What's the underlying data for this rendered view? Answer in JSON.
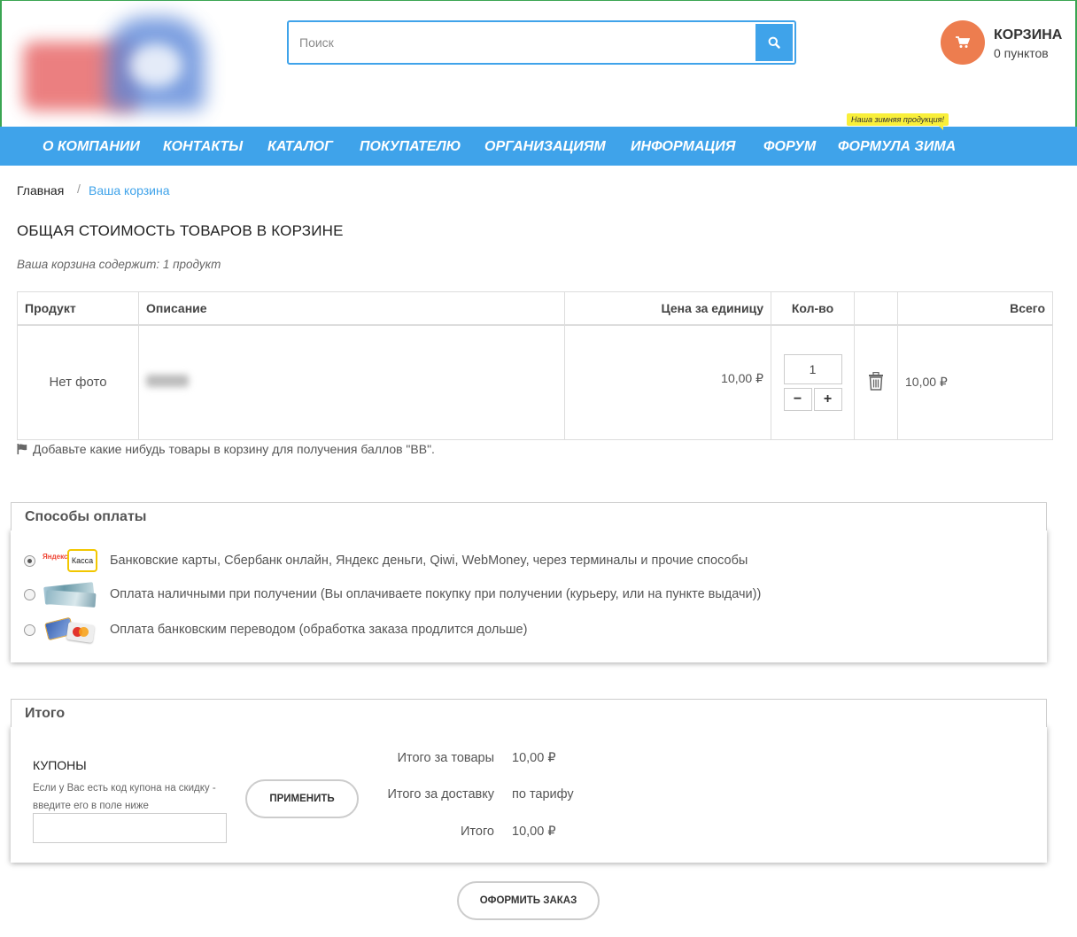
{
  "header": {
    "search_placeholder": "Поиск",
    "cart_title": "КОРЗИНА",
    "cart_points": "0 пунктов"
  },
  "nav": {
    "items": [
      "О КОМПАНИИ",
      "КОНТАКТЫ",
      "КАТАЛОГ",
      "ПОКУПАТЕЛЮ",
      "ОРГАНИЗАЦИЯМ",
      "ИНФОРМАЦИЯ",
      "ФОРУМ",
      "ФОРМУЛА ЗИМА"
    ],
    "promo_badge": "Наша зимняя продукция!"
  },
  "breadcrumb": {
    "home": "Главная",
    "separator": "/",
    "current": "Ваша корзина"
  },
  "page": {
    "title": "ОБЩАЯ СТОИМОСТЬ ТОВАРОВ В КОРЗИНЕ",
    "summary": "Ваша корзина содержит: 1 продукт"
  },
  "cart_table": {
    "headers": {
      "product": "Продукт",
      "description": "Описание",
      "unit_price": "Цена за единицу",
      "qty": "Кол-во",
      "total": "Всего"
    },
    "rows": [
      {
        "photo": "Нет фото",
        "unit_price": "10,00 ₽",
        "qty": "1",
        "total": "10,00 ₽"
      }
    ],
    "minus": "−",
    "plus": "+"
  },
  "note": "Добавьте какие нибудь товары в корзину для получения баллов \"ВВ\".",
  "payment": {
    "title": "Способы оплаты",
    "options": [
      {
        "label": "Банковские карты, Сбербанк онлайн, Яндекс деньги, Qiwi, WebMoney, через терминалы и прочие способы",
        "logo_text_1": "Яндекс",
        "logo_text_2": "Касса",
        "selected": true
      },
      {
        "label": "Оплата наличными при получении (Вы оплачиваете покупку при получении (курьеру, или на пункте выдачи))",
        "selected": false
      },
      {
        "label": "Оплата банковским переводом (обработка заказа продлится дольше)",
        "selected": false
      }
    ]
  },
  "totals": {
    "title": "Итого",
    "coupon_title": "КУПОНЫ",
    "coupon_hint": "Если у Вас есть код купона на скидку - введите его в поле ниже",
    "apply_label": "ПРИМЕНИТЬ",
    "items_label": "Итого за товары",
    "items_value": "10,00 ₽",
    "delivery_label": "Итого за доставку",
    "delivery_value": "по тарифу",
    "total_label": "Итого",
    "total_value": "10,00 ₽"
  },
  "checkout_label": "ОФОРМИТЬ ЗАКАЗ",
  "colors": {
    "accent_blue": "#3fa3ea",
    "cart_orange": "#ed7d4f",
    "promo_yellow": "#f9ef3a"
  }
}
